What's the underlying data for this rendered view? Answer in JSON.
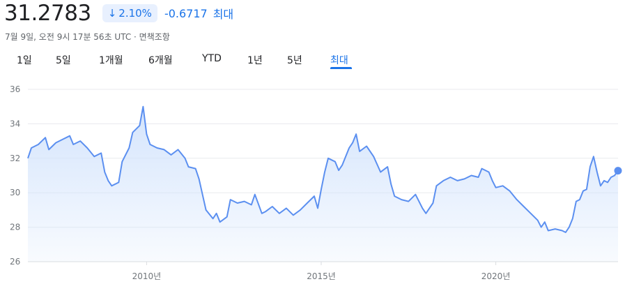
{
  "quote": {
    "price": "31.2783",
    "change_percent": "2.10%",
    "change_arrow": "↓",
    "change_value": "-0.6717",
    "period_label": "최대",
    "timestamp": "7월 9일, 오전 9시 17분 56초 UTC · 면책조항",
    "accent_color": "#1a73e8"
  },
  "tabs": [
    {
      "label": "1일",
      "active": false
    },
    {
      "label": "5일",
      "active": false
    },
    {
      "label": "1개월",
      "active": false
    },
    {
      "label": "6개월",
      "active": false
    },
    {
      "label": "YTD",
      "active": false
    },
    {
      "label": "1년",
      "active": false
    },
    {
      "label": "5년",
      "active": false
    },
    {
      "label": "최대",
      "active": true
    }
  ],
  "chart_data": {
    "type": "area",
    "title": "",
    "xlabel": "",
    "ylabel": "",
    "ylim": [
      26,
      36
    ],
    "xlim": [
      2006.6,
      2023.5
    ],
    "y_ticks": [
      26,
      28,
      30,
      32,
      34,
      36
    ],
    "x_ticks": [
      {
        "value": 2010,
        "label": "2010년"
      },
      {
        "value": 2015,
        "label": "2015년"
      },
      {
        "value": 2020,
        "label": "2020년"
      }
    ],
    "grid": true,
    "line_color": "#5b8ff0",
    "fill_color": "#d2e3fc",
    "series": [
      {
        "points": [
          [
            2006.6,
            32.0
          ],
          [
            2006.7,
            32.6
          ],
          [
            2006.9,
            32.8
          ],
          [
            2007.1,
            33.2
          ],
          [
            2007.2,
            32.5
          ],
          [
            2007.4,
            32.9
          ],
          [
            2007.6,
            33.1
          ],
          [
            2007.8,
            33.3
          ],
          [
            2007.9,
            32.8
          ],
          [
            2008.1,
            33.0
          ],
          [
            2008.3,
            32.6
          ],
          [
            2008.5,
            32.1
          ],
          [
            2008.7,
            32.3
          ],
          [
            2008.8,
            31.2
          ],
          [
            2008.9,
            30.7
          ],
          [
            2009.0,
            30.4
          ],
          [
            2009.2,
            30.6
          ],
          [
            2009.3,
            31.8
          ],
          [
            2009.5,
            32.6
          ],
          [
            2009.6,
            33.5
          ],
          [
            2009.8,
            33.9
          ],
          [
            2009.9,
            35.0
          ],
          [
            2010.0,
            33.4
          ],
          [
            2010.1,
            32.8
          ],
          [
            2010.3,
            32.6
          ],
          [
            2010.5,
            32.5
          ],
          [
            2010.7,
            32.2
          ],
          [
            2010.9,
            32.5
          ],
          [
            2011.1,
            32.0
          ],
          [
            2011.2,
            31.5
          ],
          [
            2011.4,
            31.4
          ],
          [
            2011.5,
            30.8
          ],
          [
            2011.6,
            29.9
          ],
          [
            2011.7,
            29.0
          ],
          [
            2011.9,
            28.5
          ],
          [
            2012.0,
            28.8
          ],
          [
            2012.1,
            28.3
          ],
          [
            2012.3,
            28.6
          ],
          [
            2012.4,
            29.6
          ],
          [
            2012.6,
            29.4
          ],
          [
            2012.8,
            29.5
          ],
          [
            2013.0,
            29.3
          ],
          [
            2013.1,
            29.9
          ],
          [
            2013.3,
            28.8
          ],
          [
            2013.4,
            28.9
          ],
          [
            2013.6,
            29.2
          ],
          [
            2013.8,
            28.8
          ],
          [
            2014.0,
            29.1
          ],
          [
            2014.2,
            28.7
          ],
          [
            2014.4,
            29.0
          ],
          [
            2014.6,
            29.4
          ],
          [
            2014.8,
            29.8
          ],
          [
            2014.9,
            29.1
          ],
          [
            2015.0,
            30.2
          ],
          [
            2015.1,
            31.2
          ],
          [
            2015.2,
            32.0
          ],
          [
            2015.4,
            31.8
          ],
          [
            2015.5,
            31.3
          ],
          [
            2015.6,
            31.6
          ],
          [
            2015.8,
            32.6
          ],
          [
            2015.9,
            32.9
          ],
          [
            2016.0,
            33.4
          ],
          [
            2016.1,
            32.4
          ],
          [
            2016.3,
            32.7
          ],
          [
            2016.5,
            32.1
          ],
          [
            2016.7,
            31.2
          ],
          [
            2016.9,
            31.5
          ],
          [
            2017.0,
            30.5
          ],
          [
            2017.1,
            29.8
          ],
          [
            2017.3,
            29.6
          ],
          [
            2017.5,
            29.5
          ],
          [
            2017.7,
            29.9
          ],
          [
            2017.9,
            29.1
          ],
          [
            2018.0,
            28.8
          ],
          [
            2018.2,
            29.4
          ],
          [
            2018.3,
            30.4
          ],
          [
            2018.5,
            30.7
          ],
          [
            2018.7,
            30.9
          ],
          [
            2018.9,
            30.7
          ],
          [
            2019.1,
            30.8
          ],
          [
            2019.3,
            31.0
          ],
          [
            2019.5,
            30.9
          ],
          [
            2019.6,
            31.4
          ],
          [
            2019.8,
            31.2
          ],
          [
            2019.9,
            30.7
          ],
          [
            2020.0,
            30.3
          ],
          [
            2020.2,
            30.4
          ],
          [
            2020.4,
            30.1
          ],
          [
            2020.6,
            29.6
          ],
          [
            2020.8,
            29.2
          ],
          [
            2021.0,
            28.8
          ],
          [
            2021.2,
            28.4
          ],
          [
            2021.3,
            28.0
          ],
          [
            2021.4,
            28.3
          ],
          [
            2021.5,
            27.8
          ],
          [
            2021.7,
            27.9
          ],
          [
            2021.9,
            27.8
          ],
          [
            2022.0,
            27.7
          ],
          [
            2022.1,
            28.0
          ],
          [
            2022.2,
            28.5
          ],
          [
            2022.3,
            29.5
          ],
          [
            2022.4,
            29.6
          ],
          [
            2022.5,
            30.1
          ],
          [
            2022.6,
            30.2
          ],
          [
            2022.7,
            31.5
          ],
          [
            2022.8,
            32.1
          ],
          [
            2022.9,
            31.2
          ],
          [
            2023.0,
            30.4
          ],
          [
            2023.1,
            30.7
          ],
          [
            2023.2,
            30.6
          ],
          [
            2023.3,
            30.9
          ],
          [
            2023.4,
            31.0
          ],
          [
            2023.5,
            31.28
          ]
        ]
      }
    ]
  }
}
